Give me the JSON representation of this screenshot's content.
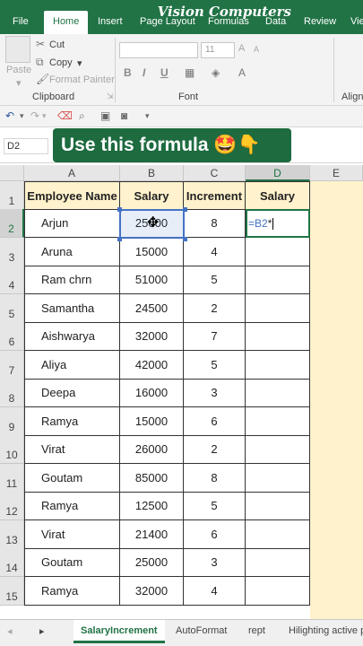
{
  "ribbon_tabs": [
    "File",
    "Home",
    "Insert",
    "Page Layout",
    "Formulas",
    "Data",
    "Review",
    "Vie"
  ],
  "brand": "Vision Computers",
  "clipboard": {
    "paste": "Paste",
    "cut": "Cut",
    "copy": "Copy",
    "format_painter": "Format Painter",
    "group_label": "Clipboard"
  },
  "font": {
    "size": "11",
    "bold": "B",
    "italic": "I",
    "underline": "U",
    "group_label": "Font"
  },
  "alignment": {
    "group_label": "Align"
  },
  "name_box": "D2",
  "banner": "Use this formula 🤩👇",
  "columns": [
    "A",
    "B",
    "C",
    "D",
    "E"
  ],
  "rows": [
    "1",
    "2",
    "3",
    "4",
    "5",
    "6",
    "7",
    "8",
    "9",
    "10",
    "11",
    "12",
    "13",
    "14",
    "15"
  ],
  "table": {
    "headers": [
      "Employee Name",
      "Salary",
      "Increment",
      "Salary"
    ],
    "data": [
      [
        "Arjun",
        "25000",
        "8"
      ],
      [
        "Aruna",
        "15000",
        "4"
      ],
      [
        "Ram chrn",
        "51000",
        "5"
      ],
      [
        "Samantha",
        "24500",
        "2"
      ],
      [
        "Aishwarya",
        "32000",
        "7"
      ],
      [
        "Aliya",
        "42000",
        "5"
      ],
      [
        "Deepa",
        "16000",
        "3"
      ],
      [
        "Ramya",
        "15000",
        "6"
      ],
      [
        "Virat",
        "26000",
        "2"
      ],
      [
        "Goutam",
        "85000",
        "8"
      ],
      [
        "Ramya",
        "12500",
        "5"
      ],
      [
        "Virat",
        "21400",
        "6"
      ],
      [
        "Goutam",
        "25000",
        "3"
      ],
      [
        "Ramya",
        "32000",
        "4"
      ]
    ],
    "formula_ref": "=B2",
    "formula_tail": "*",
    "ref_color": "#4472c4"
  },
  "sheet_tabs": [
    "SalaryIncrement",
    "AutoFormat",
    "rept",
    "Hilighting active p"
  ],
  "colors": {
    "accent": "#217346",
    "header_fill": "#fff2cc"
  }
}
